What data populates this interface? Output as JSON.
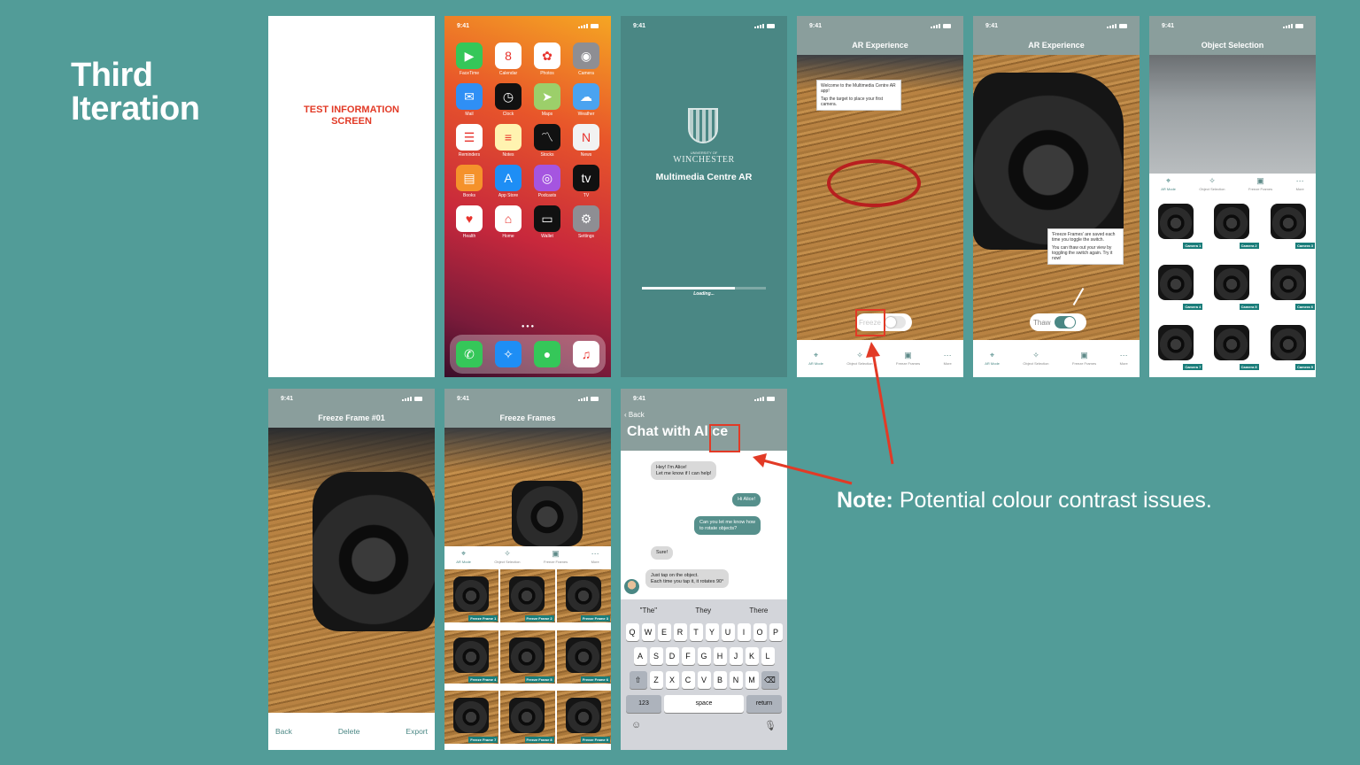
{
  "slide": {
    "title_line1": "Third",
    "title_line2": "Iteration",
    "note_label": "Note:",
    "note_text": " Potential colour contrast issues."
  },
  "status_time": "9:41",
  "test_screen": {
    "line1": "TEST INFORMATION",
    "line2": "SCREEN"
  },
  "home": {
    "day": "Monday",
    "date": "8",
    "apps": [
      {
        "label": "FaceTime",
        "icon": "facetime-icon",
        "color": "#35c759",
        "glyph": "▶"
      },
      {
        "label": "Calendar",
        "icon": "calendar-icon",
        "color": "#ffffff",
        "glyph": "8"
      },
      {
        "label": "Photos",
        "icon": "photos-icon",
        "color": "#ffffff",
        "glyph": "✿"
      },
      {
        "label": "Camera",
        "icon": "camera-icon",
        "color": "#8e8e93",
        "glyph": "◉"
      },
      {
        "label": "Mail",
        "icon": "mail-icon",
        "color": "#2f8ff5",
        "glyph": "✉"
      },
      {
        "label": "Clock",
        "icon": "clock-icon",
        "color": "#111111",
        "glyph": "◷"
      },
      {
        "label": "Maps",
        "icon": "maps-icon",
        "color": "#9ccf6a",
        "glyph": "➤"
      },
      {
        "label": "Weather",
        "icon": "weather-icon",
        "color": "#4aa3f0",
        "glyph": "☁"
      },
      {
        "label": "Reminders",
        "icon": "reminders-icon",
        "color": "#ffffff",
        "glyph": "☰"
      },
      {
        "label": "Notes",
        "icon": "notes-icon",
        "color": "#fff3b0",
        "glyph": "≡"
      },
      {
        "label": "Stocks",
        "icon": "stocks-icon",
        "color": "#111111",
        "glyph": "〽"
      },
      {
        "label": "News",
        "icon": "news-icon",
        "color": "#f2f2f2",
        "glyph": "N"
      },
      {
        "label": "Books",
        "icon": "books-icon",
        "color": "#f5922b",
        "glyph": "▤"
      },
      {
        "label": "App Store",
        "icon": "app-store-icon",
        "color": "#1e8ef5",
        "glyph": "A"
      },
      {
        "label": "Podcasts",
        "icon": "podcasts-icon",
        "color": "#a555e0",
        "glyph": "◎"
      },
      {
        "label": "TV",
        "icon": "tv-icon",
        "color": "#111111",
        "glyph": "tv"
      },
      {
        "label": "Health",
        "icon": "health-icon",
        "color": "#ffffff",
        "glyph": "♥"
      },
      {
        "label": "Home",
        "icon": "home-icon",
        "color": "#ffffff",
        "glyph": "⌂"
      },
      {
        "label": "Wallet",
        "icon": "wallet-icon",
        "color": "#111111",
        "glyph": "▭"
      },
      {
        "label": "Settings",
        "icon": "settings-icon",
        "color": "#8e8e93",
        "glyph": "⚙"
      }
    ],
    "dock": [
      {
        "icon": "phone-icon",
        "color": "#35c759",
        "glyph": "✆"
      },
      {
        "icon": "safari-icon",
        "color": "#1e8ef5",
        "glyph": "✧"
      },
      {
        "icon": "messages-icon",
        "color": "#35c759",
        "glyph": "●"
      },
      {
        "icon": "music-icon",
        "color": "#ffffff",
        "glyph": "♫"
      }
    ]
  },
  "splash": {
    "university_small": "UNIVERSITY OF",
    "university": "WINCHESTER",
    "app_name": "Multimedia Centre AR",
    "loading": "Loading...",
    "progress": 0.75
  },
  "ar1": {
    "title": "AR Experience",
    "tip_line1": "Welcome to the Multimedia Centre AR app!",
    "tip_line2": "Tap the target to place your first camera.",
    "toggle_label": "Freeze"
  },
  "ar2": {
    "title": "AR Experience",
    "tip_line1": "'Freeze Frames' are saved each time you toggle the switch.",
    "tip_line2": "You can thaw out your view by toggling the switch again. Try it now!",
    "toggle_label": "Thaw"
  },
  "tabs": [
    "AR Mode",
    "Object Selection",
    "Freeze Frames",
    "More"
  ],
  "object_selection": {
    "title": "Object Selection",
    "items": [
      "Camera 1",
      "Camera 2",
      "Camera 3",
      "Camera 4",
      "Camera 5",
      "Camera 6",
      "Camera 7",
      "Camera 8",
      "Camera 9"
    ]
  },
  "freeze_frame": {
    "title": "Freeze Frame #01",
    "back": "Back",
    "delete": "Delete",
    "export": "Export"
  },
  "freeze_frames": {
    "title": "Freeze Frames",
    "items": [
      "Freeze Frame 1",
      "Freeze Frame 2",
      "Freeze Frame 3",
      "Freeze Frame 4",
      "Freeze Frame 5",
      "Freeze Frame 6",
      "Freeze Frame 7",
      "Freeze Frame 8",
      "Freeze Frame 9"
    ]
  },
  "chat": {
    "back": "Back",
    "title": "Chat with Alice",
    "messages": [
      {
        "from": "in",
        "text": "Hey! I'm Alice!\nLet me know if I can help!"
      },
      {
        "from": "out",
        "text": "Hi Alice!"
      },
      {
        "from": "out",
        "text": "Can you let me know how\nto rotate objects?"
      },
      {
        "from": "in",
        "text": "Sure!"
      },
      {
        "from": "in",
        "text": "Just tap on the object.\nEach time you tap it, it rotates 90°"
      }
    ],
    "suggestions": [
      "\"The\"",
      "They",
      "There"
    ],
    "keys_row1": [
      "Q",
      "W",
      "E",
      "R",
      "T",
      "Y",
      "U",
      "I",
      "O",
      "P"
    ],
    "keys_row2": [
      "A",
      "S",
      "D",
      "F",
      "G",
      "H",
      "J",
      "K",
      "L"
    ],
    "keys_row3": [
      "Z",
      "X",
      "C",
      "V",
      "B",
      "N",
      "M"
    ],
    "key_123": "123",
    "key_space": "space",
    "key_return": "return"
  },
  "colors": {
    "background": "#529c98",
    "header_teal": "#4a8784",
    "annotation_red": "#e23a26",
    "error_text": "#e23a26"
  }
}
